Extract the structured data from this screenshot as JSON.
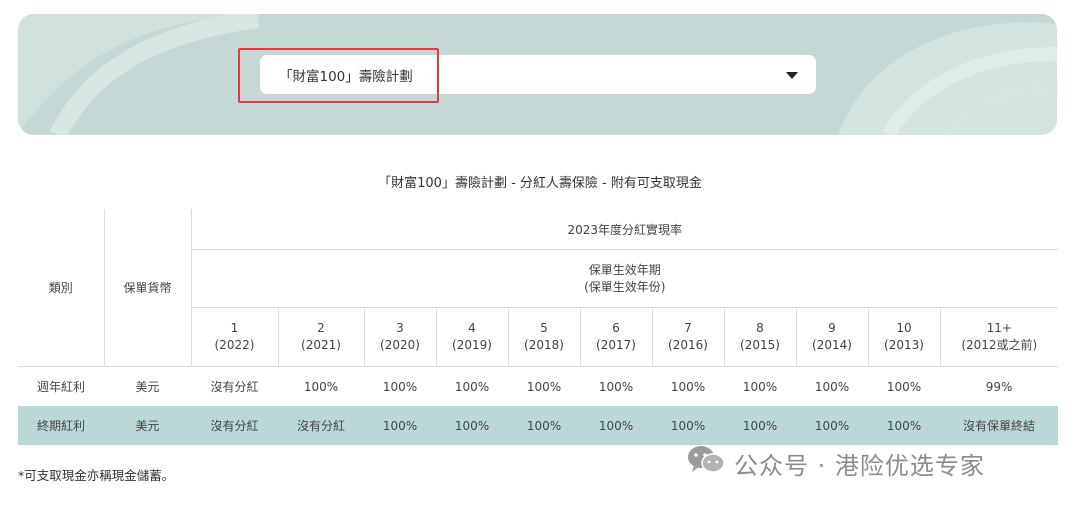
{
  "selector": {
    "value": "「財富100」壽險計劃"
  },
  "table_title": "「財富100」壽險計劃 - 分紅人壽保險 - 附有可支取現金",
  "headers": {
    "category": "類別",
    "currency": "保單貨幣",
    "rate_title": "2023年度分紅實現率",
    "year_line1": "保單生效年期",
    "year_line2": "(保單生效年份)",
    "years": [
      {
        "n": "1",
        "y": "(2022)"
      },
      {
        "n": "2",
        "y": "(2021)"
      },
      {
        "n": "3",
        "y": "(2020)"
      },
      {
        "n": "4",
        "y": "(2019)"
      },
      {
        "n": "5",
        "y": "(2018)"
      },
      {
        "n": "6",
        "y": "(2017)"
      },
      {
        "n": "7",
        "y": "(2016)"
      },
      {
        "n": "8",
        "y": "(2015)"
      },
      {
        "n": "9",
        "y": "(2014)"
      },
      {
        "n": "10",
        "y": "(2013)"
      },
      {
        "n": "11+",
        "y": "(2012或之前)"
      }
    ]
  },
  "rows": [
    {
      "category": "週年紅利",
      "currency": "美元",
      "values": [
        "沒有分紅",
        "100%",
        "100%",
        "100%",
        "100%",
        "100%",
        "100%",
        "100%",
        "100%",
        "100%",
        "99%"
      ]
    },
    {
      "category": "終期紅利",
      "currency": "美元",
      "values": [
        "沒有分紅",
        "沒有分紅",
        "100%",
        "100%",
        "100%",
        "100%",
        "100%",
        "100%",
        "100%",
        "100%",
        "沒有保單終結"
      ]
    }
  ],
  "footnote": "*可支取現金亦稱現金儲蓄。",
  "watermark": "公众号 · 港险优选专家",
  "colors": {
    "banner": "#c5d8d5",
    "alt_row": "#bad9d6",
    "highlight": "#e8383d"
  }
}
